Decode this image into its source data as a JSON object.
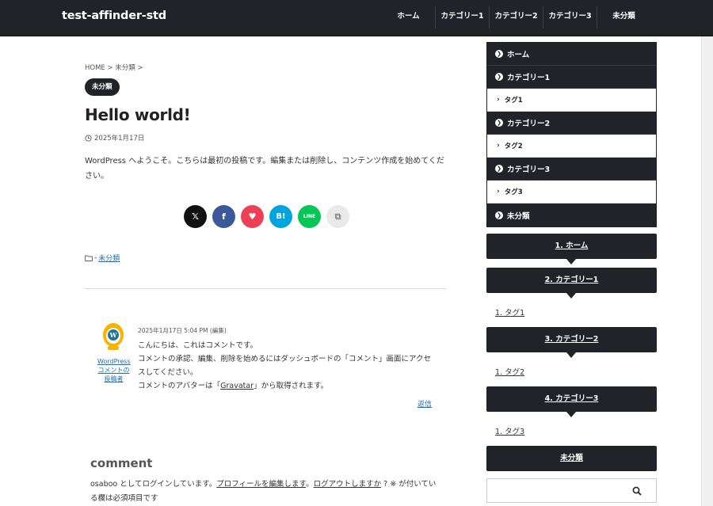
{
  "header": {
    "site_title": "test-affinder-std",
    "nav": [
      {
        "label": "ホーム"
      },
      {
        "label": "カテゴリー1"
      },
      {
        "label": "カテゴリー2"
      },
      {
        "label": "カテゴリー3"
      },
      {
        "label": "未分類"
      }
    ]
  },
  "post": {
    "breadcrumb": "HOME > 未分類 >",
    "category_badge": "未分類",
    "title": "Hello world!",
    "date": "2025年1月17日",
    "body": "WordPress へようこそ。こちらは最初の投稿です。編集または削除し、コンテンツ作成を始めてください。",
    "category_label": "未分類"
  },
  "share": {
    "x_label": "𝕏",
    "facebook_label": "f",
    "pocket_label": "♥",
    "hatena_label": "B!",
    "line_label": "LINE",
    "copy_label": "⧉"
  },
  "colors": {
    "dark": "#222329",
    "x": "#111111",
    "facebook": "#3b5998",
    "pocket": "#ef3f56",
    "hatena": "#00a4de",
    "line": "#06c755",
    "copy": "#e9e9e9",
    "link": "#1a6fb5"
  },
  "comment": {
    "author": "WordPress コメントの投稿者",
    "meta": "2025年1月17日 5:04 PM",
    "edit": "(編集)",
    "line1": "こんにちは、これはコメントです。",
    "line2": "コメントの承認、編集、削除を始めるにはダッシュボードの「コメント」画面にアクセスしてください。",
    "line3_pre": "コメントのアバターは「",
    "line3_link": "Gravatar",
    "line3_post": "」から取得されます。",
    "reply": "返信"
  },
  "comment_form": {
    "heading": "comment",
    "note_pre": "osaboo としてログインしています。",
    "profile_link": "プロフィールを編集します",
    "sep": "。",
    "logout_link": "ログアウトしますか",
    "note_post": " ? ※ が付いている欄は必須項目です"
  },
  "sidebar": {
    "menu": [
      {
        "label": "ホーム",
        "type": "parent"
      },
      {
        "label": "カテゴリー1",
        "type": "parent"
      },
      {
        "label": "タグ1",
        "type": "child"
      },
      {
        "label": "カテゴリー2",
        "type": "parent"
      },
      {
        "label": "タグ2",
        "type": "child"
      },
      {
        "label": "カテゴリー3",
        "type": "parent"
      },
      {
        "label": "タグ3",
        "type": "child"
      },
      {
        "label": "未分類",
        "type": "parent"
      }
    ],
    "boxes": [
      {
        "label": "1. ホーム"
      },
      {
        "label": "2. カテゴリー1",
        "sub": "1. タグ1"
      },
      {
        "label": "3. カテゴリー2",
        "sub": "1. タグ2"
      },
      {
        "label": "4. カテゴリー3",
        "sub": "1. タグ3"
      },
      {
        "label": "未分類"
      }
    ]
  }
}
